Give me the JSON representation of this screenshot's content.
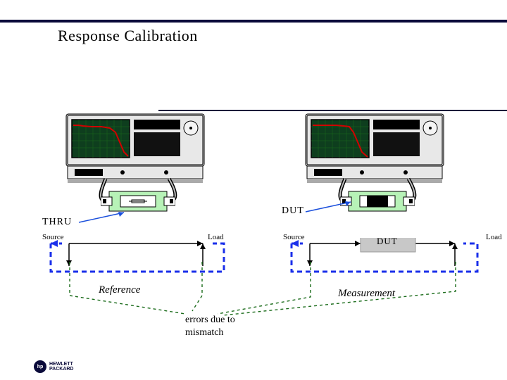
{
  "title": "Response Calibration",
  "labels": {
    "thru": "THRU",
    "dut_upper": "DUT",
    "source_left": "Source",
    "load_left": "Load",
    "source_right": "Source",
    "dut_box": "DUT",
    "load_right": "Load",
    "reference": "Reference",
    "measurement": "Measurement",
    "errors_1": "errors due to",
    "errors_2": "mismatch"
  },
  "logo": {
    "mark": "hp",
    "line1": "HEWLETT",
    "line2": "PACKARD"
  },
  "colors": {
    "nav_dark": "#0a0a3a",
    "screen": "#0e3e1e",
    "trace": "#d10000",
    "cable": "#000",
    "fixture": "#b7f2b7",
    "signal_dash": "#1a2fea",
    "arrow_blue": "#1a4fdc"
  }
}
